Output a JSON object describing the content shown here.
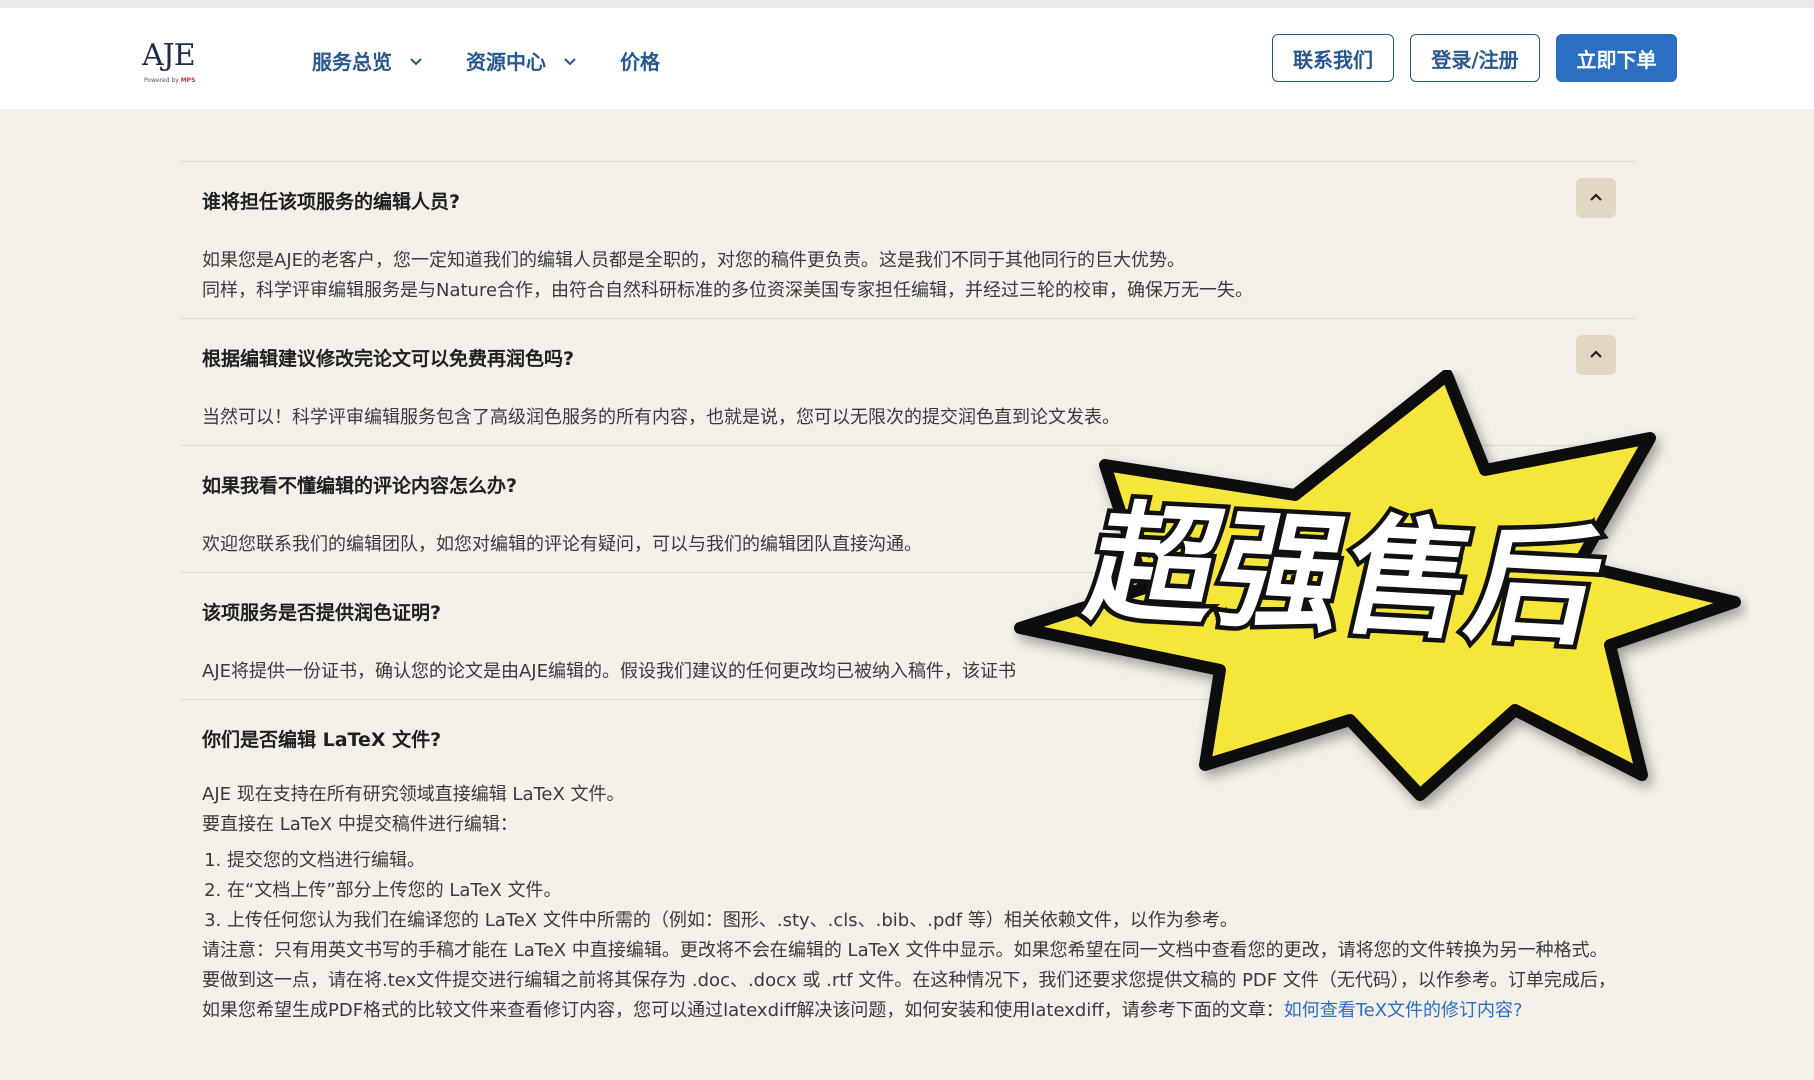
{
  "header": {
    "logo_text": "AJE",
    "logo_powered": "Powered by",
    "logo_brand": "MPS",
    "nav": [
      {
        "label": "服务总览"
      },
      {
        "label": "资源中心"
      },
      {
        "label": "价格"
      }
    ],
    "contact_label": "联系我们",
    "login_label": "登录/注册",
    "order_label": "立即下单"
  },
  "faq": [
    {
      "question": "谁将担任该项服务的编辑人员?",
      "answer": [
        "如果您是AJE的老客户，您一定知道我们的编辑人员都是全职的，对您的稿件更负责。这是我们不同于其他同行的巨大优势。",
        "同样，科学评审编辑服务是与Nature合作，由符合自然科研标准的多位资深美国专家担任编辑，并经过三轮的校审，确保万无一失。"
      ]
    },
    {
      "question": "根据编辑建议修改完论文可以免费再润色吗?",
      "answer": [
        "当然可以！科学评审编辑服务包含了高级润色服务的所有内容，也就是说，您可以无限次的提交润色直到论文发表。"
      ]
    },
    {
      "question": "如果我看不懂编辑的评论内容怎么办?",
      "answer": [
        "欢迎您联系我们的编辑团队，如您对编辑的评论有疑问，可以与我们的编辑团队直接沟通。"
      ]
    },
    {
      "question": "该项服务是否提供润色证明?",
      "answer": [
        "AJE将提供一份证书，确认您的论文是由AJE编辑的。假设我们建议的任何更改均已被纳入稿件，该证书"
      ]
    },
    {
      "question": "你们是否编辑 LaTeX 文件?",
      "answer": [
        "AJE 现在支持在所有研究领域直接编辑 LaTeX 文件。",
        "要直接在 LaTeX 中提交稿件进行编辑："
      ],
      "steps": [
        "提交您的文档进行编辑。",
        "在“文档上传”部分上传您的 LaTeX 文件。",
        "上传任何您认为我们在编译您的 LaTeX 文件中所需的（例如：图形、.sty、.cls、.bib、.pdf 等）相关依赖文件，以作为参考。"
      ],
      "note": "请注意：只有用英文书写的手稿才能在 LaTeX 中直接编辑。更改将不会在编辑的 LaTeX 文件中显示。如果您希望在同一文档中查看您的更改，请将您的文件转换为另一种格式。要做到这一点，请在将.tex文件提交进行编辑之前将其保存为 .doc、.docx 或 .rtf 文件。在这种情况下，我们还要求您提供文稿的 PDF 文件（无代码），以作参考。订单完成后，如果您希望生成PDF格式的比较文件来查看修订内容，您可以通过latexdiff解决该问题，如何安装和使用latexdiff，请参考下面的文章：",
      "note_link": "如何查看TeX文件的修订内容?"
    }
  ],
  "overlay": {
    "text": "超强售后",
    "fill_color": "#f6e53a",
    "outline_color": "#111111"
  }
}
